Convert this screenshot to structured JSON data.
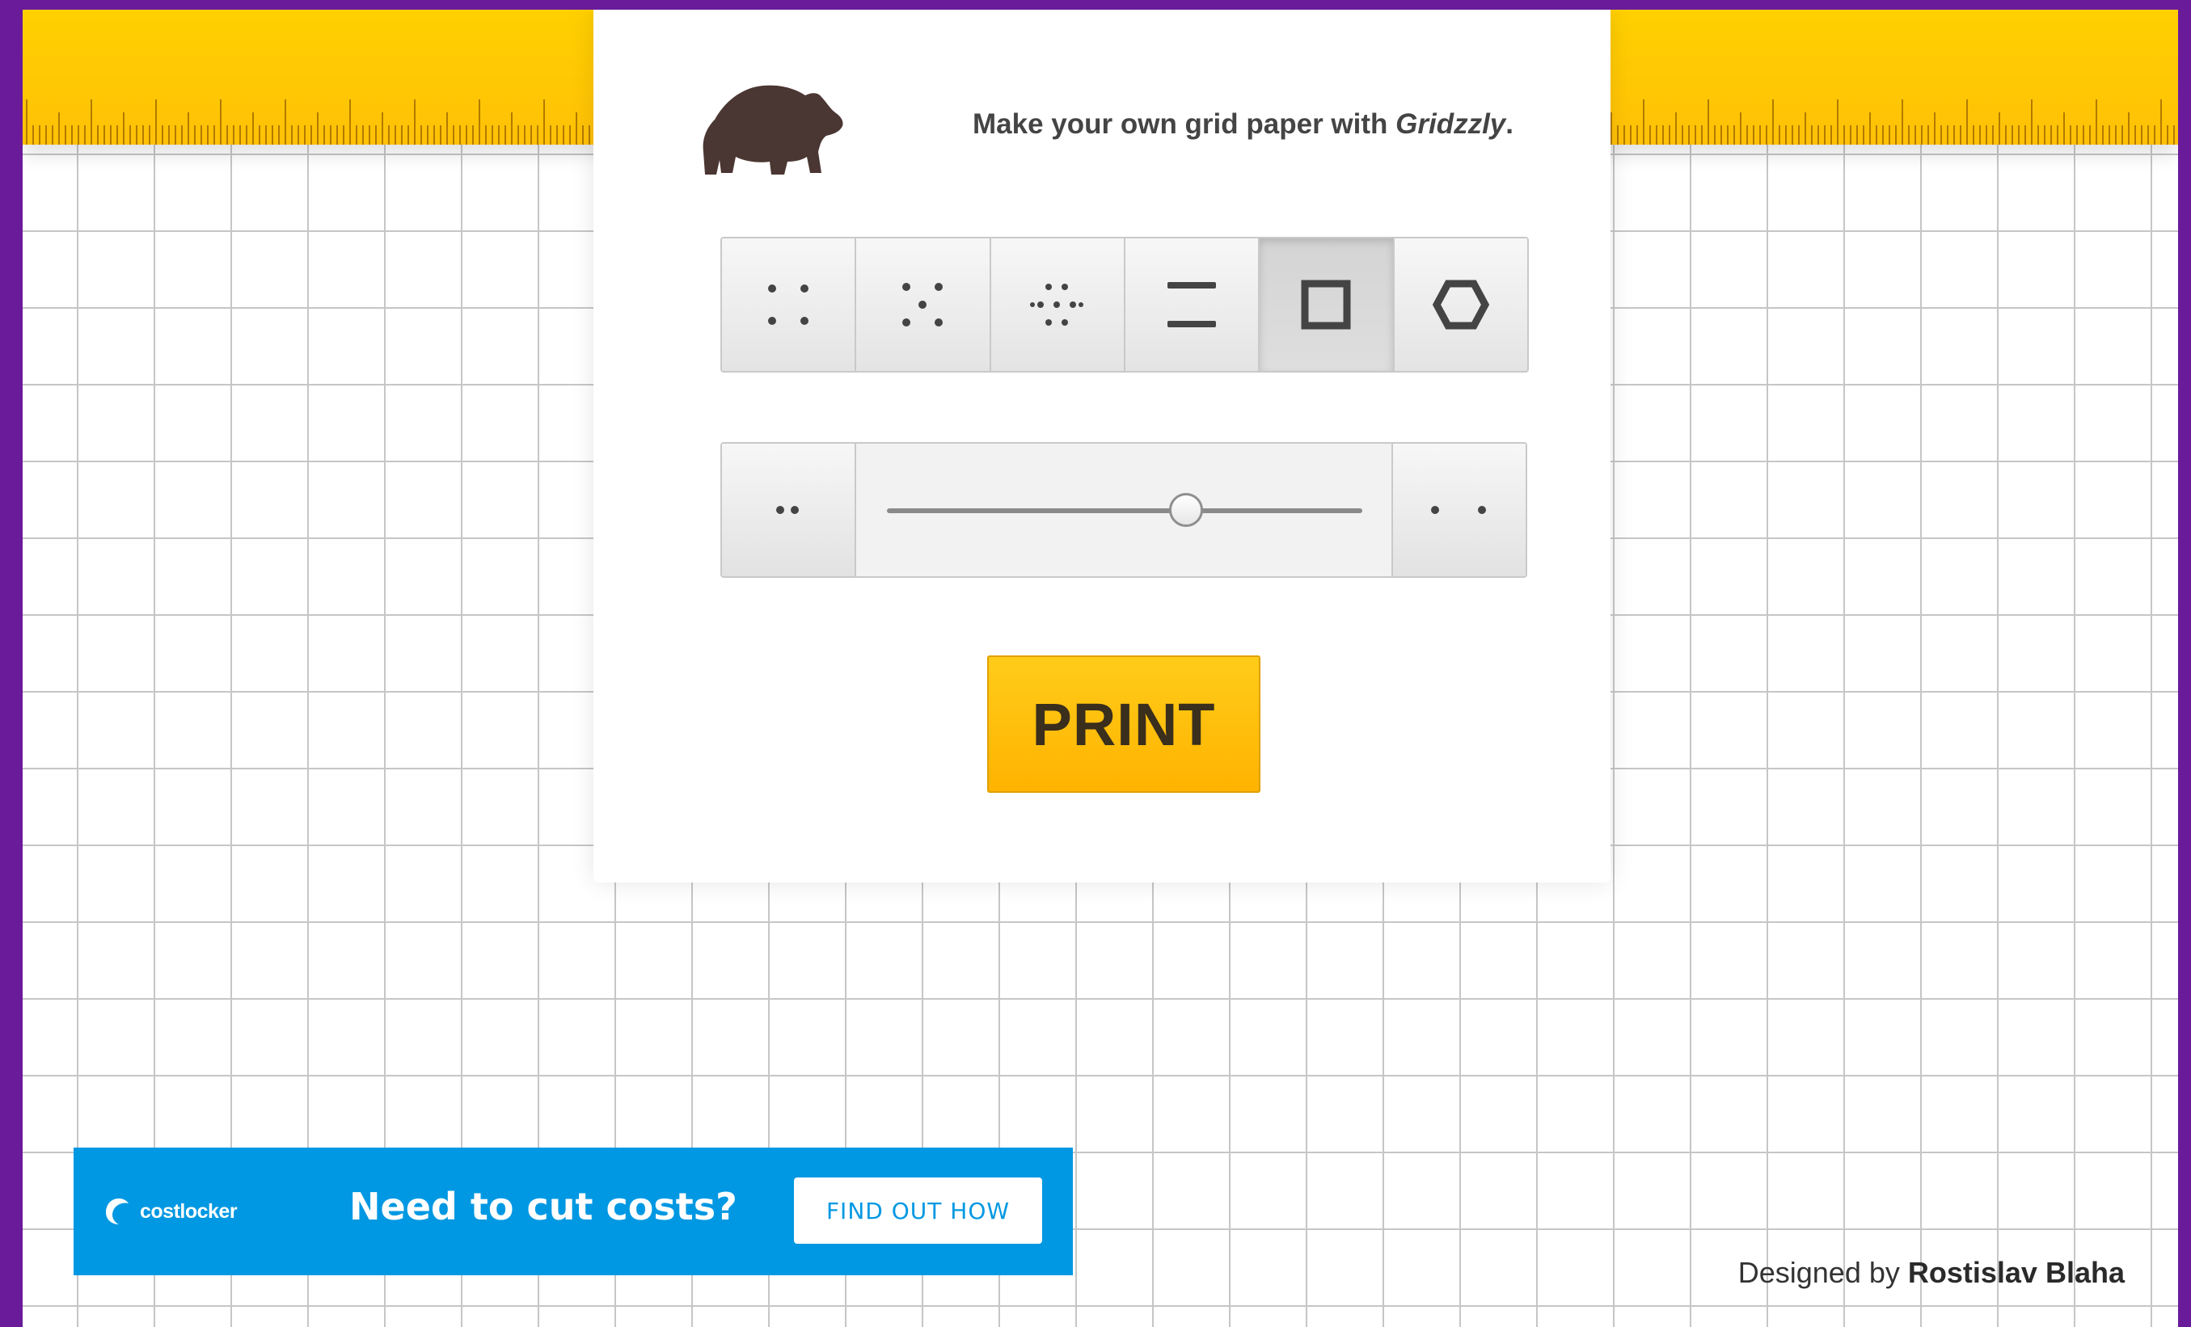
{
  "header": {
    "tagline_prefix": "Make your own grid paper with ",
    "tagline_brand": "Gridzzly",
    "tagline_suffix": ".",
    "logo_icon": "bear-icon"
  },
  "patterns": {
    "selected": "square",
    "items": [
      {
        "id": "dots",
        "icon": "dots-pattern-icon"
      },
      {
        "id": "dots-offset",
        "icon": "dots-offset-pattern-icon"
      },
      {
        "id": "dots-triangle",
        "icon": "dots-triangle-pattern-icon"
      },
      {
        "id": "lines",
        "icon": "lines-pattern-icon"
      },
      {
        "id": "square",
        "icon": "square-pattern-icon"
      },
      {
        "id": "hexagon",
        "icon": "hexagon-pattern-icon"
      }
    ]
  },
  "size_slider": {
    "value_fraction": 0.63,
    "decrease_icon": "small-spacing-icon",
    "increase_icon": "large-spacing-icon"
  },
  "actions": {
    "print_label": "PRINT"
  },
  "ad": {
    "brand": "costlocker",
    "headline": "Need to cut costs?",
    "cta_label": "FIND OUT HOW"
  },
  "footer": {
    "designed_by": "Designed by ",
    "author": "Rostislav Blaha"
  },
  "colors": {
    "frame_border": "#6a1b9a",
    "ruler": "#ffc107",
    "accent": "#ffb300",
    "ad_background": "#0098e2",
    "grid_line": "#c6c6c6"
  }
}
